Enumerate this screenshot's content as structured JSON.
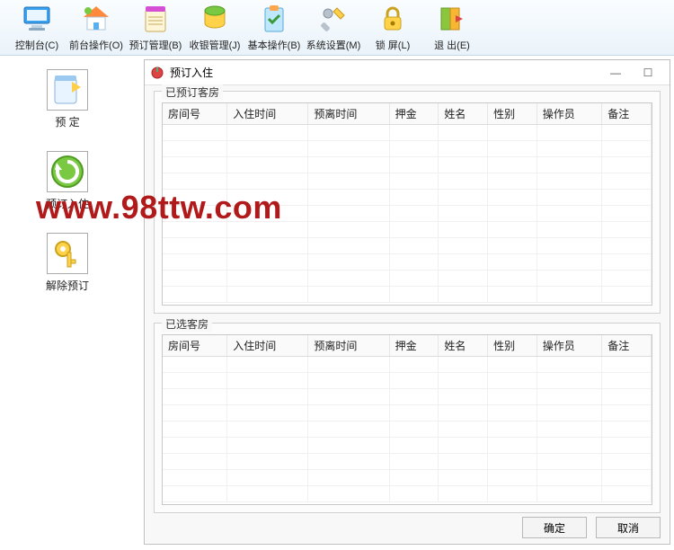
{
  "toolbar": [
    {
      "label": "控制台(C)",
      "name": "console"
    },
    {
      "label": "前台操作(O)",
      "name": "frontdesk"
    },
    {
      "label": "预订管理(B)",
      "name": "booking"
    },
    {
      "label": "收银管理(J)",
      "name": "cashier"
    },
    {
      "label": "基本操作(B)",
      "name": "basic"
    },
    {
      "label": "系统设置(M)",
      "name": "settings"
    },
    {
      "label": "锁 屏(L)",
      "name": "lock"
    },
    {
      "label": "退 出(E)",
      "name": "exit"
    }
  ],
  "sidebar": [
    {
      "label": "预 定",
      "name": "reserve"
    },
    {
      "label": "预订入住",
      "name": "checkin-reserve"
    },
    {
      "label": "解除预订",
      "name": "cancel-reserve"
    }
  ],
  "dialog": {
    "title": "预订入住",
    "group1_title": "已预订客房",
    "group2_title": "已选客房",
    "columns": [
      "房间号",
      "入住时间",
      "预离时间",
      "押金",
      "姓名",
      "性别",
      "操作员",
      "备注"
    ],
    "rows1": [],
    "rows2": [],
    "btn_ok": "确定",
    "btn_cancel": "取消"
  },
  "watermark": "www.98ttw.com"
}
